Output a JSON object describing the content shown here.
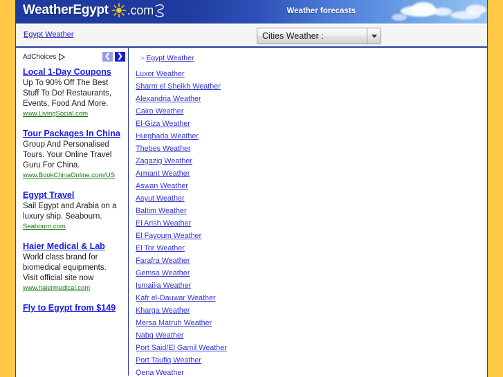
{
  "header": {
    "logo_main": "WeatherEgypt",
    "logo_dotcom": "com",
    "logo_dot": ".",
    "sun_icon": "sun-icon",
    "cloud_icon": "cloud-swirl-icon",
    "tagline": "Weather forecasts",
    "colors": {
      "banner_dark": "#1f3ba0",
      "banner_light": "#9ac5f3",
      "border_gold": "#ffc846",
      "border_blue": "#2b3f9e"
    }
  },
  "navbar": {
    "home_link": "Egypt Weather",
    "select": {
      "selected": "Cities Weather :",
      "options": [
        "Cities Weather :"
      ],
      "caret_icon": "chevron-down-icon"
    }
  },
  "ads": {
    "adchoices_label": "AdChoices",
    "adchoices_icon": "adchoices-triangle-icon",
    "prev_label": "❮",
    "next_label": "❯",
    "items": [
      {
        "title": "Local 1-Day Coupons",
        "desc": "Up To 90% Off The Best Stuff To Do! Restaurants, Events, Food And More.",
        "url": "www.LivingSocial.com"
      },
      {
        "title": "Tour Packages In China",
        "desc": "Group And Personalised Tours. Your Online Travel Guru For China.",
        "url": "www.BookChinaOnline.com/US"
      },
      {
        "title": "Egypt Travel",
        "desc": "Sail Egypt and Arabia on a luxury ship. Seabourn.",
        "url": "Seabourn.com"
      },
      {
        "title": "Haier Medical & Lab",
        "desc": "World class brand for biomedical equipments. Visit official site now",
        "url": "www.haiermedical.com"
      },
      {
        "title": "Fly to Egypt from $149",
        "desc": "",
        "url": ""
      }
    ]
  },
  "content": {
    "breadcrumb_caret": ">",
    "breadcrumb_link": "Egypt Weather",
    "city_links": [
      "Luxor Weather",
      "Sharm el Sheikh Weather",
      "Alexandria Weather",
      "Cairo Weather",
      "El-Giza Weather",
      "Hurghada Weather",
      "Thebes Weather",
      "Zagazig Weather",
      "Armant Weather",
      "Aswan Weather",
      "Asyut Weather",
      "Baltim Weather",
      "El Arish Weather",
      "El Fayoum Weather",
      "El Tor Weather",
      "Farafra Weather",
      "Gemsa Weather",
      "Ismailia Weather",
      "Kafr el-Dauwar Weather",
      "Kharga Weather",
      "Mersa Matruh Weather",
      "Nabq Weather",
      "Port Said/El Gamil Weather",
      "Port Taufiq Weather",
      "Qena Weather"
    ]
  }
}
